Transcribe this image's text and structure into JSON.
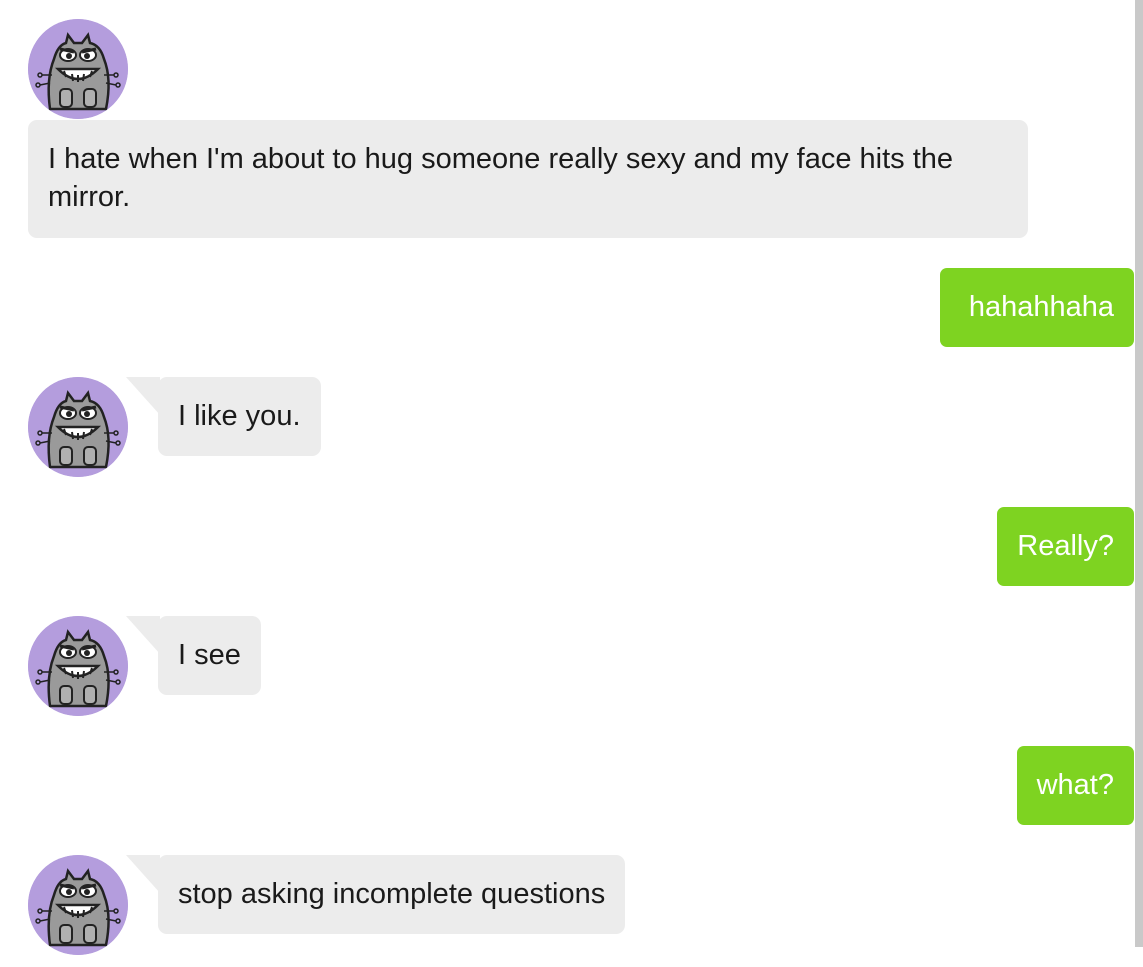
{
  "messages": [
    {
      "sender": "bot",
      "text": "I hate when I'm about to hug someone really sexy and my face hits the mirror."
    },
    {
      "sender": "user",
      "text": "hahahhaha"
    },
    {
      "sender": "bot",
      "text": "I like you."
    },
    {
      "sender": "user",
      "text": "Really?"
    },
    {
      "sender": "bot",
      "text": "I see"
    },
    {
      "sender": "user",
      "text": "what?"
    },
    {
      "sender": "bot",
      "text": "stop asking incomplete questions"
    }
  ],
  "colors": {
    "bot_bubble": "#ececec",
    "user_bubble": "#7ed321",
    "avatar_background": "#b49ddd"
  },
  "avatar_icon": "grinning-gray-monster-icon"
}
